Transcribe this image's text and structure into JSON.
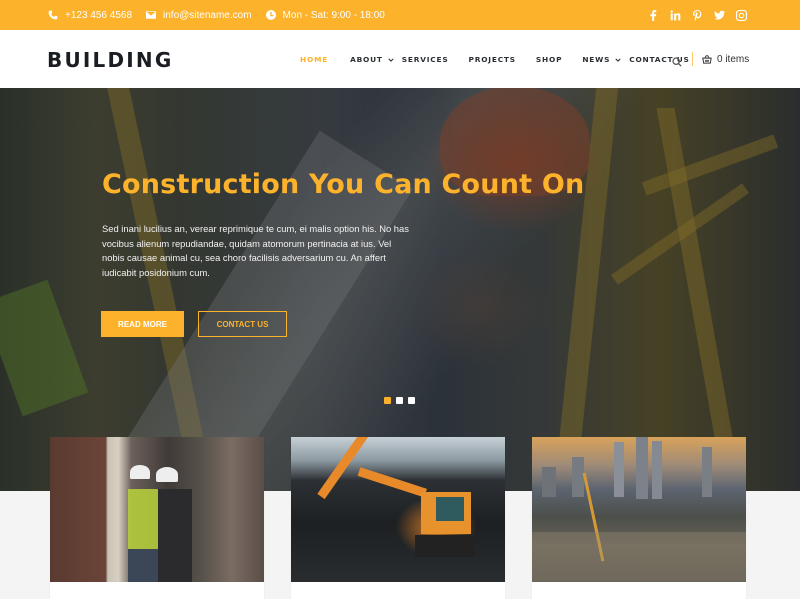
{
  "topbar": {
    "phone": "+123 456 4568",
    "email": "info@sitename.com",
    "hours": "Mon - Sat: 9:00 - 18:00",
    "socials": [
      "facebook",
      "linkedin",
      "pinterest",
      "twitter",
      "instagram"
    ]
  },
  "header": {
    "logo": "BUILDING",
    "nav": [
      {
        "label": "HOME",
        "active": true
      },
      {
        "label": "ABOUT",
        "dropdown": true
      },
      {
        "label": "SERVICES"
      },
      {
        "label": "PROJECTS"
      },
      {
        "label": "SHOP"
      },
      {
        "label": "NEWS",
        "dropdown": true
      },
      {
        "label": "CONTACT US"
      }
    ],
    "cart_label": "0 items"
  },
  "hero": {
    "title": "Construction You Can Count On",
    "text": "Sed inani lucilius an, verear reprimique te cum, ei malis option his. No has vocibus alienum repudiandae, quidam atomorum pertinacia at ius. Vel nobis causae animal cu, sea choro facilisis adversarium cu. An affert iudicabit posidonium cum.",
    "primary_button": "READ MORE",
    "secondary_button": "CONTACT US",
    "slides": 3,
    "active_slide": 1
  },
  "cards": [
    {
      "image": "workers-in-hard-hats"
    },
    {
      "image": "orange-excavator"
    },
    {
      "image": "city-construction-site"
    }
  ],
  "colors": {
    "accent": "#fdb22b",
    "dark": "#1a1e23"
  }
}
